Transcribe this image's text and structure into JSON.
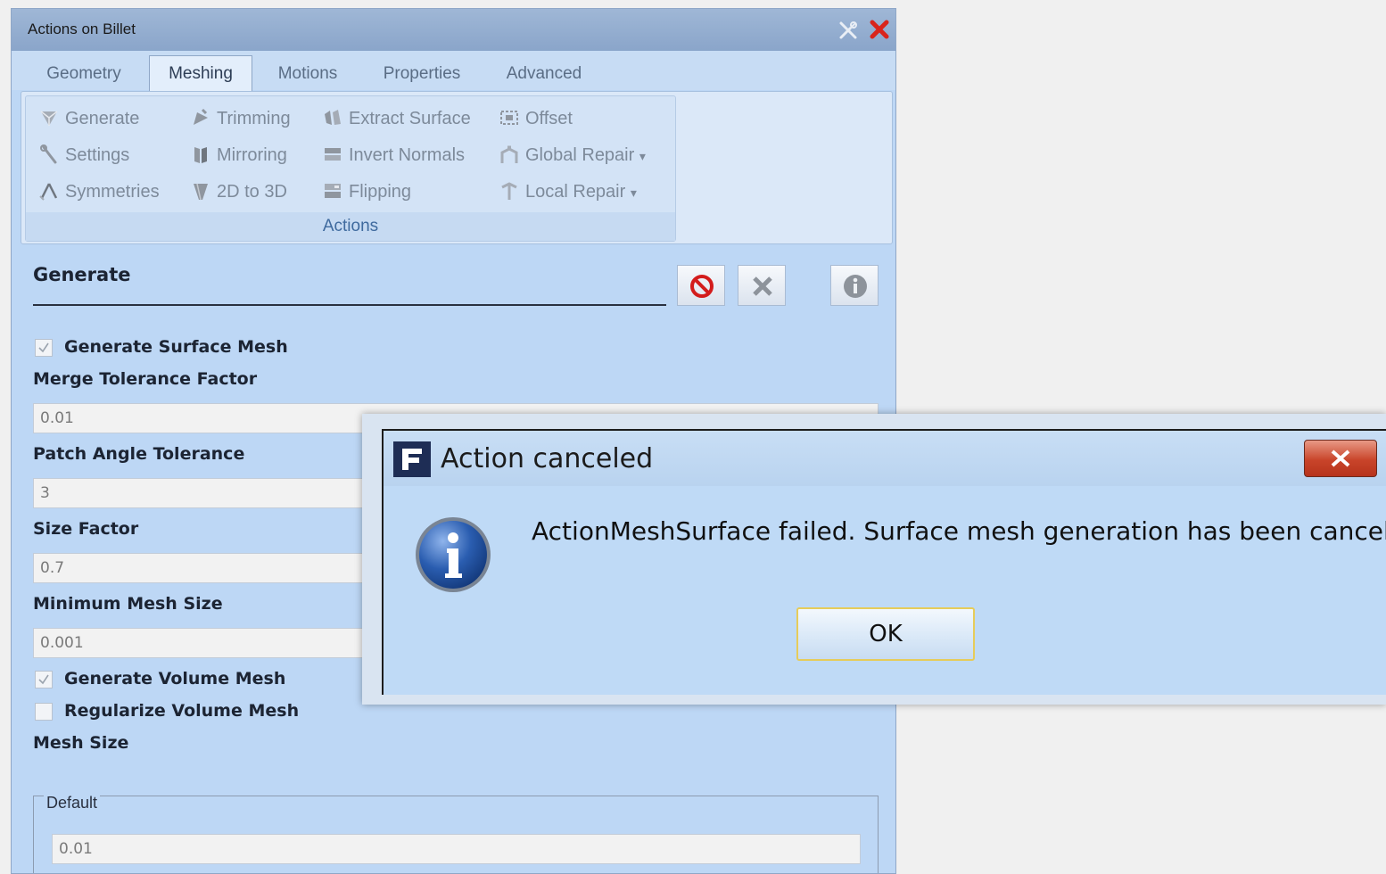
{
  "panel": {
    "title": "Actions on Billet",
    "title_icons": [
      "tools-icon",
      "close-icon"
    ],
    "tabs": [
      {
        "label": "Geometry",
        "active": false
      },
      {
        "label": "Meshing",
        "active": true
      },
      {
        "label": "Motions",
        "active": false
      },
      {
        "label": "Properties",
        "active": false
      },
      {
        "label": "Advanced",
        "active": false
      }
    ],
    "ribbon": {
      "group_label": "Actions",
      "buttons": {
        "generate": "Generate",
        "trimming": "Trimming",
        "extract_surface": "Extract Surface",
        "offset": "Offset",
        "settings": "Settings",
        "mirroring": "Mirroring",
        "invert_normals": "Invert Normals",
        "global_repair": "Global Repair",
        "symmetries": "Symmetries",
        "twod_to_threed": "2D to 3D",
        "flipping": "Flipping",
        "local_repair": "Local Repair"
      },
      "dropdown_arrow": "▾"
    }
  },
  "form": {
    "section_title": "Generate",
    "action_buttons": [
      "cancel-action-icon",
      "delete-icon",
      "info-icon"
    ],
    "generate_surface_mesh": {
      "label": "Generate Surface Mesh",
      "checked": true
    },
    "merge_tolerance_factor": {
      "label": "Merge Tolerance Factor",
      "value": "0.01"
    },
    "patch_angle_tolerance": {
      "label": "Patch Angle Tolerance",
      "value": "3"
    },
    "size_factor": {
      "label": "Size Factor",
      "value": "0.7"
    },
    "minimum_mesh_size": {
      "label": "Minimum Mesh Size",
      "value": "0.001"
    },
    "generate_volume_mesh": {
      "label": "Generate Volume Mesh",
      "checked": true
    },
    "regularize_volume_mesh": {
      "label": "Regularize Volume Mesh",
      "checked": false
    },
    "mesh_size": {
      "label": "Mesh Size",
      "group_label": "Default",
      "value": "0.01"
    }
  },
  "dialog": {
    "title": "Action canceled",
    "logo_letter": "F",
    "message": "ActionMeshSurface failed. Surface mesh generation has been cancelled.",
    "ok_label": "OK",
    "colors": {
      "logo": "#1e2d55",
      "close": "#c9442a",
      "info": "#2a5db0"
    }
  }
}
